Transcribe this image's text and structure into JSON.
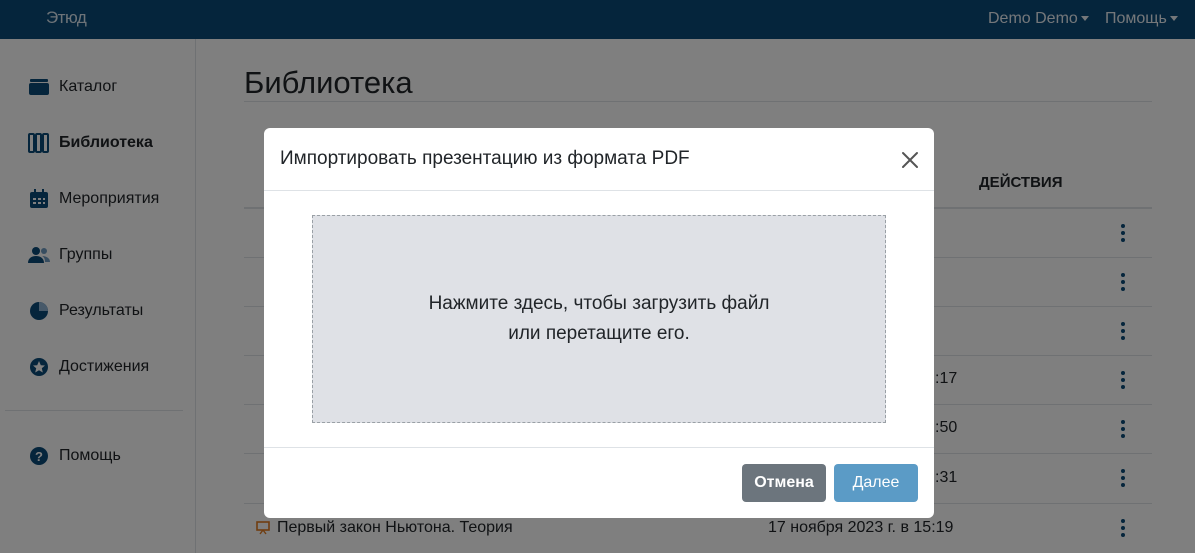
{
  "topbar": {
    "logo": "Этюд",
    "user_menu": "Demo Demo",
    "help_menu": "Помощь"
  },
  "sidebar": {
    "items": [
      {
        "label": "Каталог",
        "icon": "catalog-icon",
        "active": false
      },
      {
        "label": "Библиотека",
        "icon": "library-icon",
        "active": true
      },
      {
        "label": "Мероприятия",
        "icon": "calendar-icon",
        "active": false
      },
      {
        "label": "Группы",
        "icon": "users-icon",
        "active": false
      },
      {
        "label": "Результаты",
        "icon": "pie-chart-icon",
        "active": false
      },
      {
        "label": "Достижения",
        "icon": "star-icon",
        "active": false
      }
    ],
    "help": {
      "label": "Помощь",
      "icon": "question-icon"
    }
  },
  "main": {
    "title": "Библиотека",
    "table": {
      "actions_header": "ДЕЙСТВИЯ",
      "rows": [
        {
          "name": "",
          "date": ""
        },
        {
          "name": "",
          "date": ""
        },
        {
          "name": "",
          "date": ""
        },
        {
          "name": "",
          "date": ":17"
        },
        {
          "name": "",
          "date": ":50"
        },
        {
          "name": "",
          "date": ":31"
        },
        {
          "name": "Первый закон Ньютона. Теория",
          "date": "17 ноября 2023 г. в 15:19"
        }
      ]
    }
  },
  "modal": {
    "title": "Импортировать презентацию из формата PDF",
    "dropzone_line1": "Нажмите здесь, чтобы загрузить файл",
    "dropzone_line2": "или перетащите его.",
    "cancel_label": "Отмена",
    "next_label": "Далее"
  },
  "colors": {
    "topbar": "#0b4b78",
    "accent": "#5b9bc6",
    "cancel": "#6c757d"
  }
}
